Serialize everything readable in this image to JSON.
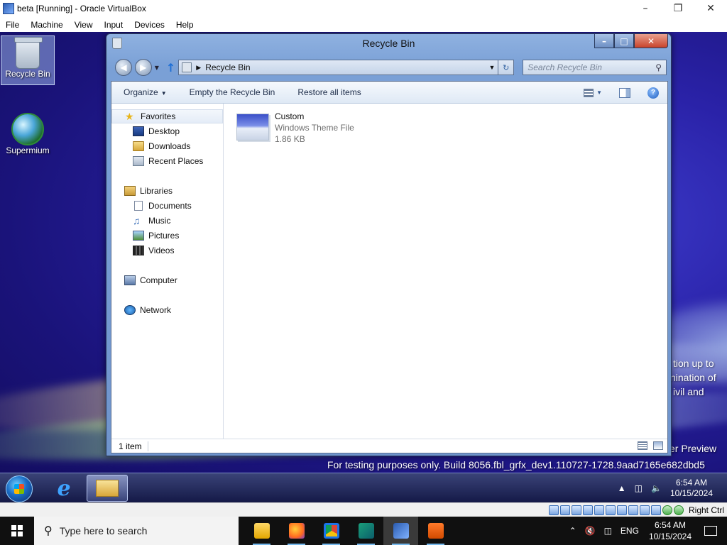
{
  "vbox": {
    "title": "beta [Running] - Oracle VirtualBox",
    "menu": [
      "File",
      "Machine",
      "View",
      "Input",
      "Devices",
      "Help"
    ],
    "host_key": "Right Ctrl"
  },
  "desktop": {
    "icons": [
      {
        "label": "Recycle Bin",
        "icon": "recycle-bin-icon",
        "selected": true
      },
      {
        "label": "Supermium",
        "icon": "supermium-icon",
        "selected": false
      }
    ],
    "watermark": {
      "lines_right": [
        "tion up to",
        "nination of",
        "ivil and"
      ],
      "preview": "er Preview",
      "build": "For testing purposes only. Build 8056.fbl_grfx_dev1.110727-1728.9aad7165e682dbd5"
    }
  },
  "explorer": {
    "title": "Recycle Bin",
    "address": "Recycle Bin",
    "search_placeholder": "Search Recycle Bin",
    "commands": {
      "organize": "Organize",
      "empty": "Empty the Recycle Bin",
      "restore": "Restore all items"
    },
    "nav": {
      "favorites": "Favorites",
      "desktop": "Desktop",
      "downloads": "Downloads",
      "recent": "Recent Places",
      "libraries": "Libraries",
      "documents": "Documents",
      "music": "Music",
      "pictures": "Pictures",
      "videos": "Videos",
      "computer": "Computer",
      "network": "Network"
    },
    "files": [
      {
        "name": "Custom",
        "type": "Windows Theme File",
        "size": "1.86 KB"
      }
    ],
    "status": "1 item"
  },
  "guest_taskbar": {
    "time": "6:54 AM",
    "date": "10/15/2024"
  },
  "host_taskbar": {
    "search_placeholder": "Type here to search",
    "lang": "ENG",
    "time": "6:54 AM",
    "date": "10/15/2024"
  },
  "colors": {
    "desktop_blue": "#2a22a8",
    "host_taskbar": "#101010",
    "accent": "#76b9ed"
  }
}
